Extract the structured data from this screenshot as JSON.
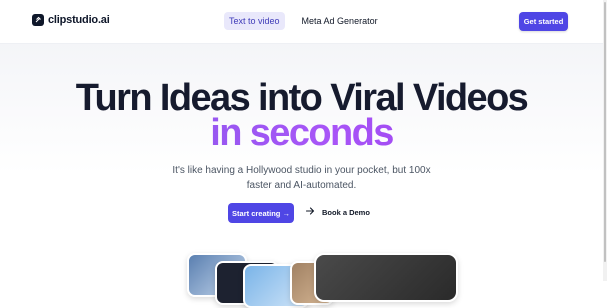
{
  "brand": {
    "name": "clipstudio.ai"
  },
  "nav": [
    {
      "label": "Text to video",
      "active": true
    },
    {
      "label": "Meta Ad Generator",
      "active": false
    }
  ],
  "header": {
    "cta_label": "Get started"
  },
  "hero": {
    "title_line1": "Turn Ideas into Viral Videos",
    "title_line2": "in seconds",
    "subtitle_line1": "It's like having a Hollywood studio in your pocket, but 100x",
    "subtitle_line2": "faster and AI-automated.",
    "primary_cta": "Start creating →",
    "secondary_cta": "Book a Demo"
  },
  "colors": {
    "accent": "#4f46e5",
    "gradient_start": "#7c5ce6",
    "gradient_end": "#9333ea"
  },
  "icons": {
    "logo": "clip-logo-icon",
    "demo": "arrow-right-icon"
  }
}
